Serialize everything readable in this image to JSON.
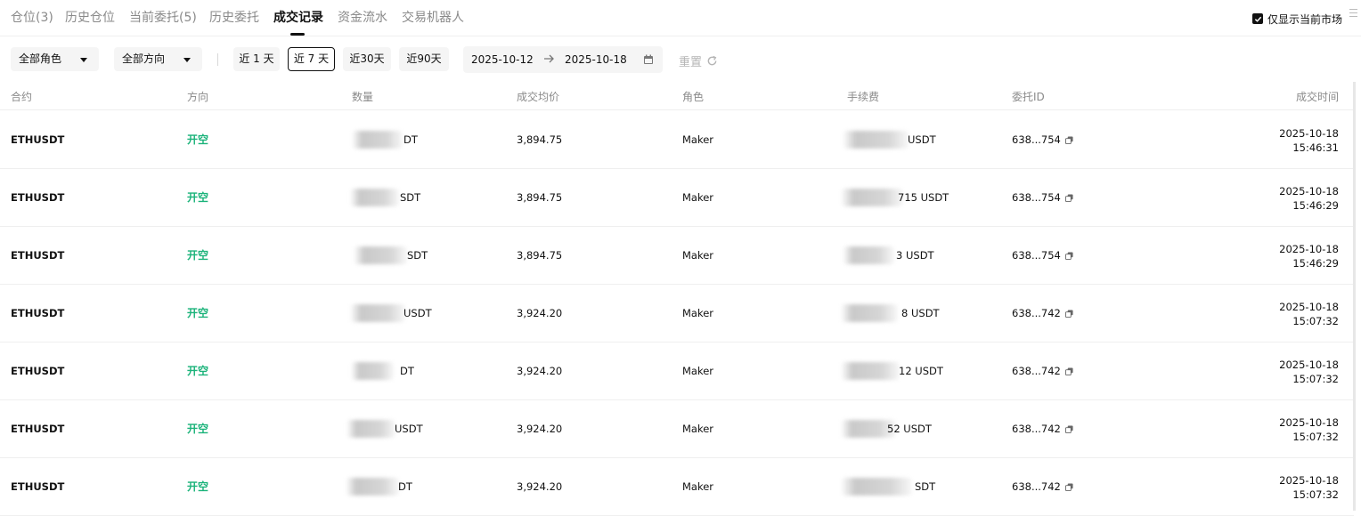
{
  "tabs": [
    {
      "label": "仓位(3)"
    },
    {
      "label": "历史仓位"
    },
    {
      "label": "当前委托(5)"
    },
    {
      "label": "历史委托"
    },
    {
      "label": "成交记录"
    },
    {
      "label": "资金流水"
    },
    {
      "label": "交易机器人"
    }
  ],
  "active_tab": "成交记录",
  "only_current_market": {
    "label": "仅显示当前市场",
    "checked": true
  },
  "filters": {
    "role": "全部角色",
    "direction": "全部方向",
    "ranges": [
      "近 1 天",
      "近 7 天",
      "近30天",
      "近90天"
    ],
    "active_range": "近 7 天",
    "date_from": "2025-10-12",
    "date_to": "2025-10-18",
    "reset_label": "重置"
  },
  "table": {
    "columns": [
      "合约",
      "方向",
      "数量",
      "成交均价",
      "角色",
      "手续费",
      "委托ID",
      "成交时间"
    ],
    "rows": [
      {
        "symbol": "ETHUSDT",
        "side": "开空",
        "qty_visible": "DT",
        "price": "3,894.75",
        "role": "Maker",
        "fee_visible": "USDT",
        "order_id": "638...754",
        "date": "2025-10-18",
        "time": "15:46:31"
      },
      {
        "symbol": "ETHUSDT",
        "side": "开空",
        "qty_visible": "SDT",
        "price": "3,894.75",
        "role": "Maker",
        "fee_visible": "715 USDT",
        "order_id": "638...754",
        "date": "2025-10-18",
        "time": "15:46:29"
      },
      {
        "symbol": "ETHUSDT",
        "side": "开空",
        "qty_visible": "SDT",
        "price": "3,894.75",
        "role": "Maker",
        "fee_visible": "3 USDT",
        "order_id": "638...754",
        "date": "2025-10-18",
        "time": "15:46:29"
      },
      {
        "symbol": "ETHUSDT",
        "side": "开空",
        "qty_visible": "USDT",
        "price": "3,924.20",
        "role": "Maker",
        "fee_visible": "8 USDT",
        "order_id": "638...742",
        "date": "2025-10-18",
        "time": "15:07:32"
      },
      {
        "symbol": "ETHUSDT",
        "side": "开空",
        "qty_visible": "DT",
        "price": "3,924.20",
        "role": "Maker",
        "fee_visible": "12 USDT",
        "order_id": "638...742",
        "date": "2025-10-18",
        "time": "15:07:32"
      },
      {
        "symbol": "ETHUSDT",
        "side": "开空",
        "qty_visible": "USDT",
        "price": "3,924.20",
        "role": "Maker",
        "fee_visible": "52 USDT",
        "order_id": "638...742",
        "date": "2025-10-18",
        "time": "15:07:32"
      },
      {
        "symbol": "ETHUSDT",
        "side": "开空",
        "qty_visible": "DT",
        "price": "3,924.20",
        "role": "Maker",
        "fee_visible": "SDT",
        "order_id": "638...742",
        "date": "2025-10-18",
        "time": "15:07:32"
      }
    ]
  },
  "colors": {
    "sell": "#1bb37a",
    "muted": "#8a8a8a",
    "text": "#111111"
  },
  "icons": [
    "checkbox-icon",
    "caret-down-icon",
    "arrow-right-icon",
    "calendar-icon",
    "refresh-icon",
    "copy-icon",
    "menu-icon"
  ]
}
